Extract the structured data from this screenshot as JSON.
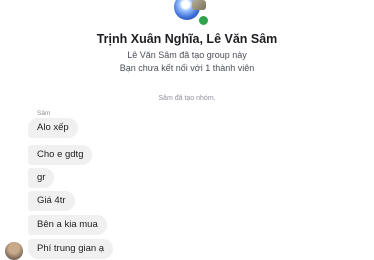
{
  "conversation": {
    "group_name": "Trịnh Xuân Nghĩa, Lê Văn Sâm",
    "created_info": "Lê Văn Sâm đã tạo group này",
    "connection_info": "Bạn chưa kết nối với 1 thành viên",
    "system_message": "Sâm đã tạo nhóm.",
    "sender_name": "Sâm",
    "messages": [
      "Alo xếp",
      "Cho e gdtg",
      "gr",
      "Giá 4tr",
      "Bên a kia mua",
      "Phí trung gian ạ"
    ]
  },
  "colors": {
    "bubble_bg": "#f0f0f0",
    "online_dot": "#31a24c"
  }
}
